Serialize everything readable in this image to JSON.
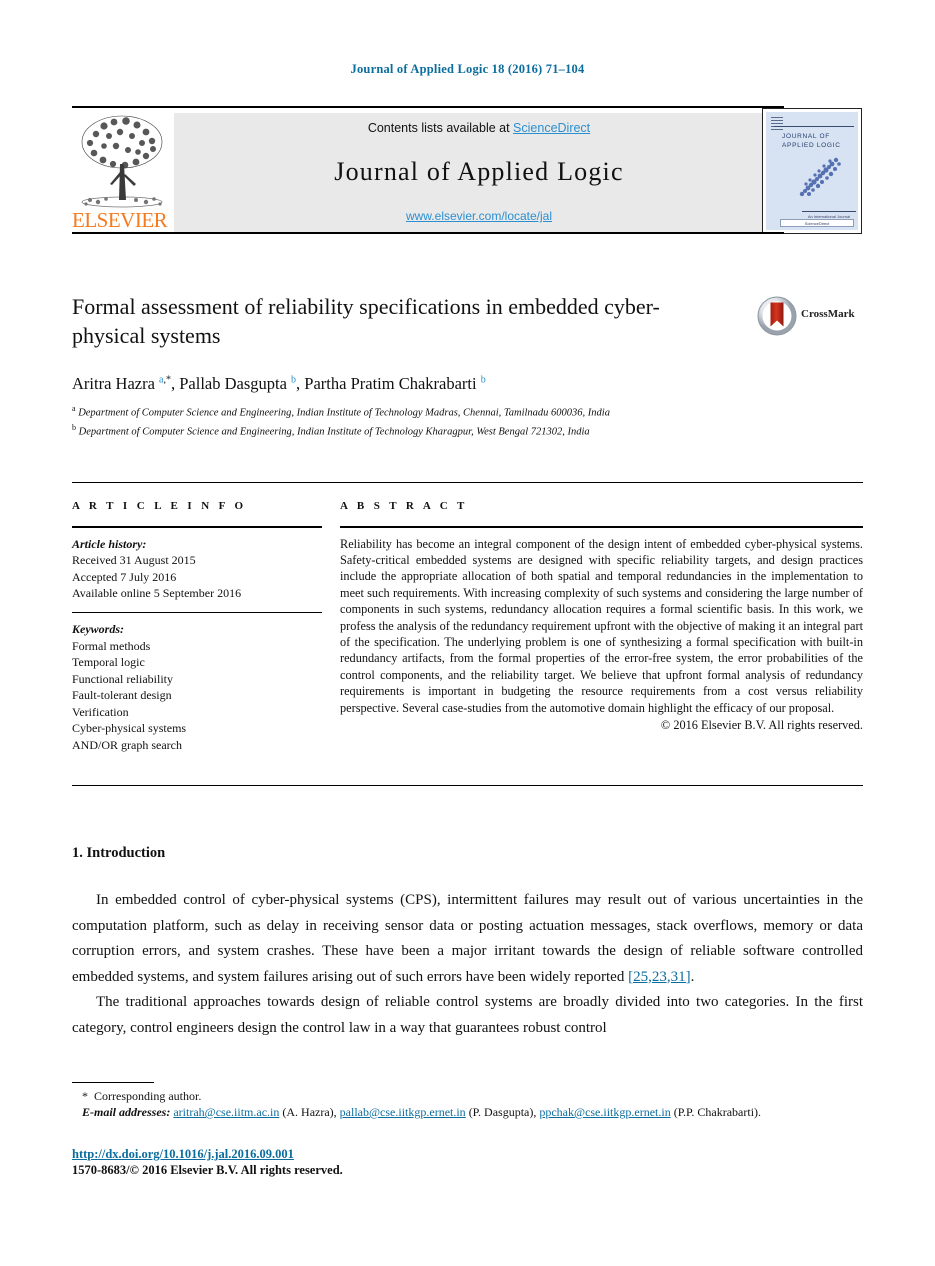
{
  "running_head": "Journal of Applied Logic 18 (2016) 71–104",
  "masthead": {
    "contents_prefix": "Contents lists available at ",
    "sciencedirect": "ScienceDirect",
    "journal_title": "Journal of Applied Logic",
    "journal_url": "www.elsevier.com/locate/jal",
    "publisher_wordmark": "ELSEVIER",
    "cover": {
      "title_line1": "JOURNAL OF",
      "title_line2": "APPLIED LOGIC",
      "footer_small": "An International Journal",
      "footer_box": "ScienceDirect"
    }
  },
  "article": {
    "title": "Formal assessment of reliability specifications in embedded cyber-physical systems",
    "crossmark_label": "CrossMark",
    "authors_html": "Aritra Hazra <sup class=\"aff\">a</sup><sup class=\"star\">,*</sup>, Pallab Dasgupta <sup class=\"aff\">b</sup>, Partha Pratim Chakrabarti <sup class=\"aff\">b</sup>",
    "affiliations_html": "<sup>a</sup> Department of Computer Science and Engineering, Indian Institute of Technology Madras, Chennai, Tamilnadu 600036, India<br><sup>b</sup> Department of Computer Science and Engineering, Indian Institute of Technology Kharagpur, West Bengal 721302, India"
  },
  "info": {
    "heading": "A R T I C L E   I N F O",
    "history_label": "Article history:",
    "history": [
      "Received 31 August 2015",
      "Accepted 7 July 2016",
      "Available online 5 September 2016"
    ],
    "keywords_label": "Keywords:",
    "keywords": [
      "Formal methods",
      "Temporal logic",
      "Functional reliability",
      "Fault-tolerant design",
      "Verification",
      "Cyber-physical systems",
      "AND/OR graph search"
    ]
  },
  "abstract": {
    "heading": "A B S T R A C T",
    "text": "Reliability has become an integral component of the design intent of embedded cyber-physical systems. Safety-critical embedded systems are designed with specific reliability targets, and design practices include the appropriate allocation of both spatial and temporal redundancies in the implementation to meet such requirements. With increasing complexity of such systems and considering the large number of components in such systems, redundancy allocation requires a formal scientific basis. In this work, we profess the analysis of the redundancy requirement upfront with the objective of making it an integral part of the specification. The underlying problem is one of synthesizing a formal specification with built-in redundancy artifacts, from the formal properties of the error-free system, the error probabilities of the control components, and the reliability target. We believe that upfront formal analysis of redundancy requirements is important in budgeting the resource requirements from a cost versus reliability perspective. Several case-studies from the automotive domain highlight the efficacy of our proposal.",
    "copyright": "© 2016 Elsevier B.V. All rights reserved."
  },
  "body": {
    "section_title": "1. Introduction",
    "paragraph1_a": "In embedded control of cyber-physical systems (CPS), intermittent failures may result out of various uncertainties in the computation platform, such as delay in receiving sensor data or posting actuation messages, stack overflows, memory or data corruption errors, and system crashes. These have been a major irritant towards the design of reliable software controlled embedded systems, and system failures arising out of such errors have been widely reported ",
    "paragraph1_cite": "[25,23,31]",
    "paragraph1_b": ".",
    "paragraph2": "The traditional approaches towards design of reliable control systems are broadly divided into two categories. In the first category, control engineers design the control law in a way that guarantees robust control"
  },
  "footnotes": {
    "corresponding": "Corresponding author.",
    "email_label": "E-mail addresses:",
    "emails": [
      {
        "address": "aritrah@cse.iitm.ac.in",
        "person": "(A. Hazra)"
      },
      {
        "address": "pallab@cse.iitkgp.ernet.in",
        "person": "(P. Dasgupta)"
      },
      {
        "address": "ppchak@cse.iitkgp.ernet.in",
        "person": "(P.P. Chakrabarti)."
      }
    ],
    "doi": "http://dx.doi.org/10.1016/j.jal.2016.09.001",
    "issn_copyright": "1570-8683/© 2016 Elsevier B.V. All rights reserved."
  },
  "colors": {
    "link_blue": "#0b6d9e",
    "sciencedirect_blue": "#2b8fd0",
    "elsevier_orange": "#F47B20",
    "masthead_grey": "#e9e9e9"
  }
}
